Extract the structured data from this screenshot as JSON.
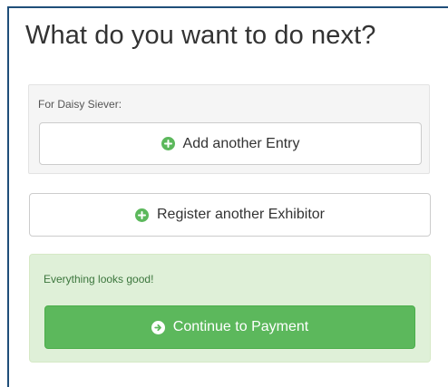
{
  "heading": "What do you want to do next?",
  "entry_section": {
    "label": "For Daisy Siever:",
    "add_entry_label": "Add another Entry",
    "add_entry_icon": "plus-circle-icon"
  },
  "register_label": "Register another Exhibitor",
  "register_icon": "plus-circle-icon",
  "status": {
    "message": "Everything looks good!",
    "continue_label": "Continue to Payment",
    "continue_icon": "arrow-right-circle-icon"
  },
  "colors": {
    "accent_green": "#5cb85c",
    "success_bg": "#dff0d8",
    "success_text": "#3c763d",
    "frame_border": "#1f4e79"
  }
}
